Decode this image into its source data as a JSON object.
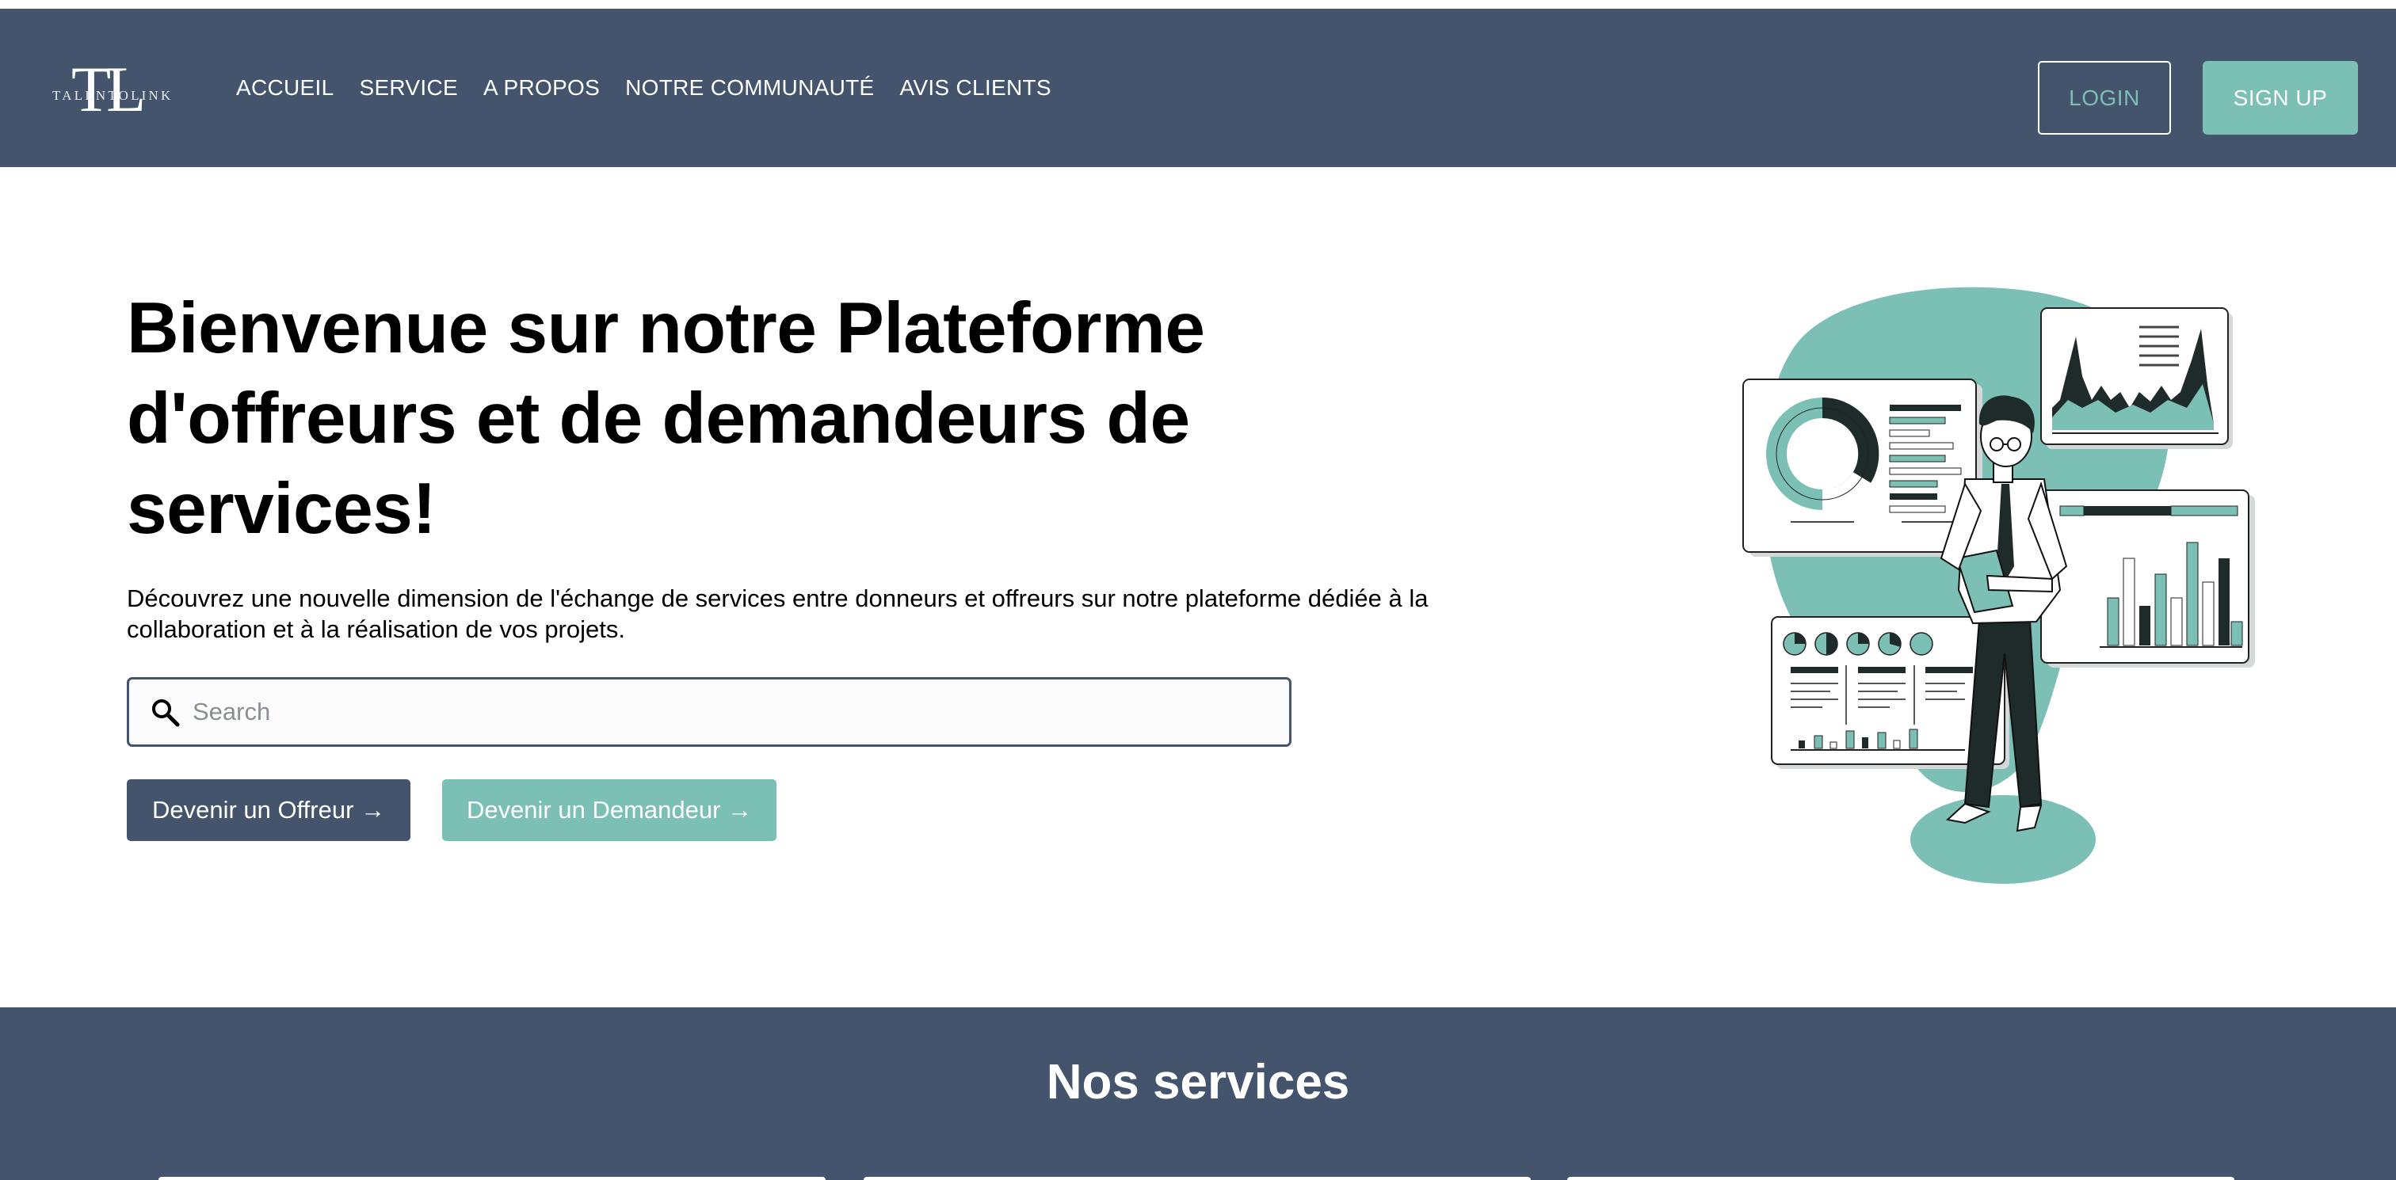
{
  "brand": {
    "monogram": "TL",
    "wordmark": "TALENTOLINK"
  },
  "nav": {
    "items": [
      {
        "label": "ACCUEIL"
      },
      {
        "label": "SERVICE"
      },
      {
        "label": "A PROPOS"
      },
      {
        "label": "NOTRE COMMUNAUTÉ"
      },
      {
        "label": "AVIS CLIENTS"
      }
    ],
    "login_label": "LOGIN",
    "signup_label": "SIGN UP"
  },
  "hero": {
    "title": "Bienvenue sur notre Plateforme d'offreurs et de demandeurs de services!",
    "description": "Découvrez une nouvelle dimension de l'échange de services entre donneurs et offreurs sur notre plateforme dédiée à la collaboration et à la réalisation de vos projets.",
    "search": {
      "placeholder": "Search",
      "value": ""
    },
    "btn_offreur": "Devenir un Offreur →",
    "btn_demandeur": "Devenir un Demandeur →",
    "illustration_icon": "analytics-dashboard-illustration"
  },
  "services": {
    "title": "Nos services"
  },
  "colors": {
    "navy": "#43546c",
    "teal": "#7bbfb5",
    "white": "#ffffff",
    "text": "#000000"
  }
}
